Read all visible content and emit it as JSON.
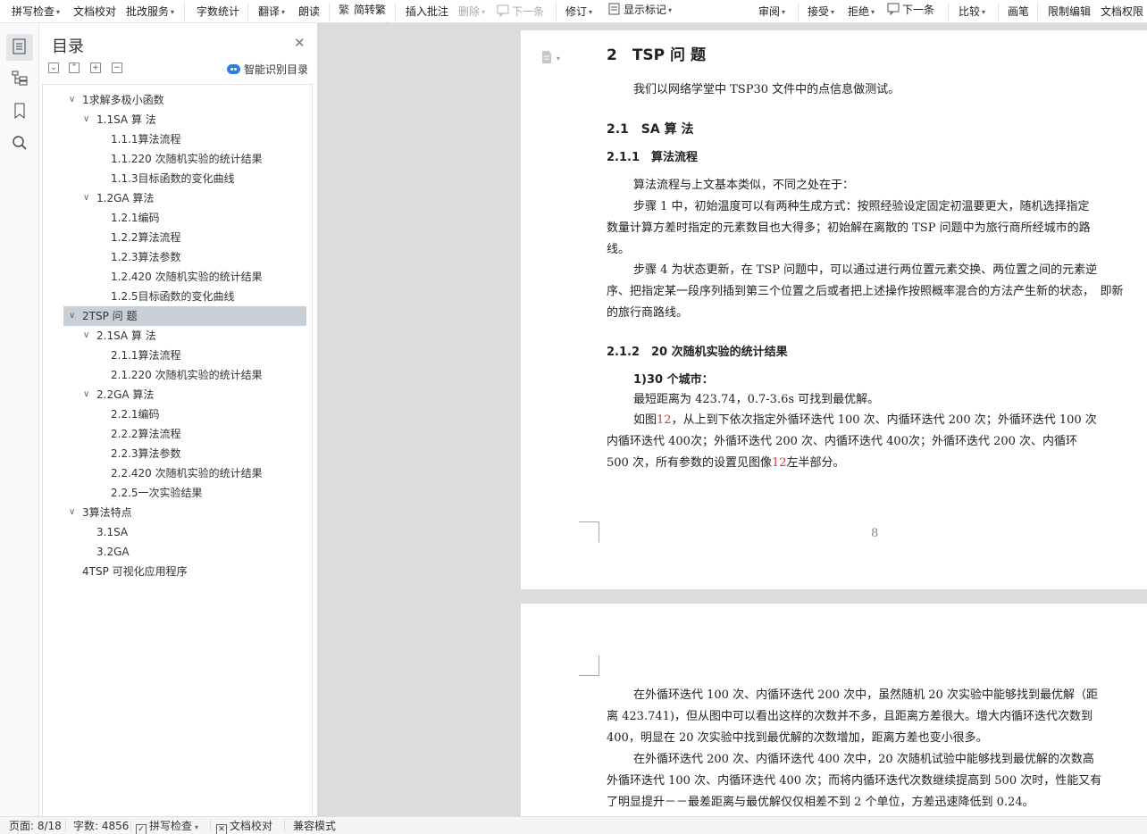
{
  "toolbar": {
    "spell_check": "拼写检查",
    "doc_proofread": "文档校对",
    "grading_service": "批改服务",
    "word_count": "字数统计",
    "translate": "翻译",
    "read_aloud": "朗读",
    "trad_to_simp": "简转繁",
    "insert_comment": "插入批注",
    "delete": "删除",
    "next_comment": "下一条",
    "track_changes": "修订",
    "show_markup": "显示标记",
    "review": "审阅",
    "accept": "接受",
    "reject": "拒绝",
    "next_change": "下一条",
    "compare": "比较",
    "pen": "画笔",
    "restrict_editing": "限制编辑",
    "doc_permission": "文档权限"
  },
  "toc": {
    "title": "目录",
    "smart_label": "智能识别目录",
    "items": [
      {
        "label": "1求解多极小函数",
        "level": 1,
        "expanded": true
      },
      {
        "label": "1.1SA 算 法",
        "level": 2,
        "expanded": true
      },
      {
        "label": "1.1.1算法流程",
        "level": 3
      },
      {
        "label": "1.1.220 次随机实验的统计结果",
        "level": 3
      },
      {
        "label": "1.1.3目标函数的变化曲线",
        "level": 3
      },
      {
        "label": "1.2GA 算法",
        "level": 2,
        "expanded": true
      },
      {
        "label": "1.2.1编码",
        "level": 3
      },
      {
        "label": "1.2.2算法流程",
        "level": 3
      },
      {
        "label": "1.2.3算法参数",
        "level": 3
      },
      {
        "label": "1.2.420 次随机实验的统计结果",
        "level": 3
      },
      {
        "label": "1.2.5目标函数的变化曲线",
        "level": 3
      },
      {
        "label": "2TSP 问 题",
        "level": 1,
        "expanded": true,
        "selected": true
      },
      {
        "label": "2.1SA 算 法",
        "level": 2,
        "expanded": true
      },
      {
        "label": "2.1.1算法流程",
        "level": 3
      },
      {
        "label": "2.1.220 次随机实验的统计结果",
        "level": 3
      },
      {
        "label": "2.2GA 算法",
        "level": 2,
        "expanded": true
      },
      {
        "label": "2.2.1编码",
        "level": 3
      },
      {
        "label": "2.2.2算法流程",
        "level": 3
      },
      {
        "label": "2.2.3算法参数",
        "level": 3
      },
      {
        "label": "2.2.420 次随机实验的统计结果",
        "level": 3
      },
      {
        "label": "2.2.5一次实验结果",
        "level": 3
      },
      {
        "label": "3算法特点",
        "level": 1,
        "expanded": true
      },
      {
        "label": "3.1SA",
        "level": 2
      },
      {
        "label": "3.2GA",
        "level": 2
      },
      {
        "label": "4TSP 可视化应用程序",
        "level": 1
      }
    ]
  },
  "doc": {
    "h1": "2　TSP 问 题",
    "intro": "我们以网络学堂中 TSP30 文件中的点信息做测试。",
    "h2_1": "2.1　SA 算 法",
    "h3_1": "2.1.1　算法流程",
    "p1": "算法流程与上文基本类似，不同之处在于：",
    "p2a": "步骤 1 中，初始温度可以有两种生成方式：按照经验设定固定初温要更大，随机选择指定",
    "p2b": "数量计算方差时指定的元素数目也大得多；初始解在离散的 TSP 问题中为旅行商所经城市的路",
    "p2c": "线。",
    "p3a": "步骤 4 为状态更新，在 TSP 问题中，可以通过进行两位置元素交换、两位置之间的元素逆",
    "p3b": "序、把指定某一段序列插到第三个位置之后或者把上述操作按照概率混合的方法产生新的状态，　即新",
    "p3c": "的旅行商路线。",
    "h3_2": "2.1.2　20 次随机实验的统计结果",
    "sub1": "1)30 个城市：",
    "p4": "最短距离为 423.74，0.7-3.6s 可找到最优解。",
    "p5a_pre": "如图",
    "fig_ref": "12",
    "p5a_post": "，从上到下依次指定外循环迭代 100 次、内循环迭代 200 次；外循环迭代 100 次",
    "p5b": "内循环迭代 400次；外循环迭代 200 次、内循环迭代 400次；外循环迭代 200 次、内循环",
    "p5c_pre": "500 次，所有参数的设置见图像",
    "p5c_post": "左半部分。",
    "page_number": "8",
    "p6a": "在外循环迭代 100 次、内循环迭代 200 次中，虽然随机 20 次实验中能够找到最优解（距",
    "p6b": "离 423.741)，但从图中可以看出这样的次数并不多，且距离方差很大。增大内循环迭代次数到",
    "p6c": "400，明显在 20 次实验中找到最优解的次数增加，距离方差也变小很多。",
    "p7a": "在外循环迭代 200 次、内循环迭代 400 次中，20 次随机试验中能够找到最优解的次数高",
    "p7b": "外循环迭代 100 次、内循环迭代 400 次；而将内循环迭代次数继续提高到 500 次时，性能又有",
    "p7c": "了明显提升－－最差距离与最优解仅仅相差不到 2 个单位，方差迅速降低到 0.24。"
  },
  "status": {
    "page": "页面: 8/18",
    "words": "字数: 4856",
    "spell": "拼写检查",
    "proof": "文档校对",
    "compat": "兼容模式"
  },
  "colors": {
    "accent": "#2f7de1",
    "selection": "#c9cfd6",
    "fig_ref": "#e23636"
  }
}
